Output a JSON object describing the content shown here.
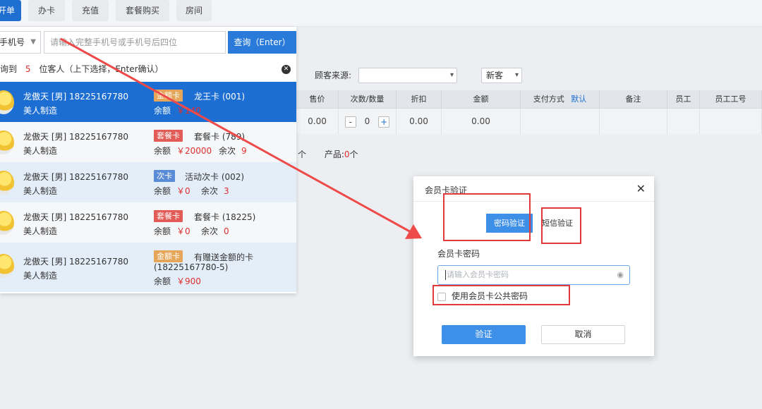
{
  "tabs": [
    {
      "label": "开单",
      "active": true
    },
    {
      "label": "办卡",
      "active": false
    },
    {
      "label": "充值",
      "active": false
    },
    {
      "label": "套餐购买",
      "active": false
    },
    {
      "label": "房间",
      "active": false
    }
  ],
  "search": {
    "type": "手机号",
    "placeholder": "请输入完整手机号或手机号后四位",
    "button": "查询（Enter）"
  },
  "result_info": {
    "prefix": "询到",
    "count": "5",
    "suffix": "位客人（上下选择，Enter确认）"
  },
  "customers": [
    {
      "name": "龙傲天 [男] 18225167780",
      "shop": "美人制造",
      "badge": "金额卡",
      "card": "龙王卡 (001)",
      "balance_label": "余额",
      "balance": "￥140",
      "count_label": "",
      "count": ""
    },
    {
      "name": "龙傲天 [男] 18225167780",
      "shop": "美人制造",
      "badge": "套餐卡",
      "card": "套餐卡 (789)",
      "balance_label": "余额",
      "balance": "￥20000",
      "count_label": "余次",
      "count": "9"
    },
    {
      "name": "龙傲天 [男] 18225167780",
      "shop": "美人制造",
      "badge": "次卡",
      "card": "活动次卡 (002)",
      "balance_label": "余额",
      "balance": "￥0",
      "count_label": "余次",
      "count": "3"
    },
    {
      "name": "龙傲天 [男] 18225167780",
      "shop": "美人制造",
      "badge": "套餐卡",
      "card": "套餐卡 (18225)",
      "balance_label": "余额",
      "balance": "￥0",
      "count_label": "余次",
      "count": "0"
    },
    {
      "name": "龙傲天 [男] 18225167780",
      "shop": "美人制造",
      "badge": "金额卡",
      "card": "有赠送金额的卡",
      "card_line2": "(18225167780-5)",
      "balance_label": "余额",
      "balance": "￥900",
      "count_label": "",
      "count": ""
    }
  ],
  "filters": {
    "source_label": "顾客来源:",
    "source_value": "",
    "customer_type": "新客"
  },
  "table": {
    "headers": [
      "售价",
      "次数/数量",
      "折扣",
      "金额",
      "支付方式",
      "备注",
      "员工",
      "员工工号"
    ],
    "pay_default": "默认",
    "row": {
      "price": "0.00",
      "qty": "0",
      "discount": "0.00",
      "amount": "0.00"
    },
    "minus": "-",
    "plus": "+"
  },
  "summary": {
    "frag": "个",
    "product_label": "产品:",
    "product_count": "0",
    "product_unit": "个"
  },
  "modal": {
    "title": "会员卡验证",
    "tab_password": "密码验证",
    "tab_sms": "短信验证",
    "field_label": "会员卡密码",
    "placeholder": "请输入会员卡密码",
    "checkbox_label": "使用会员卡公共密码",
    "confirm": "验证",
    "cancel": "取消"
  },
  "colors": {
    "accent": "#1f6fd1",
    "highlight": "#e33a3a",
    "price_red": "#e02e2e"
  }
}
